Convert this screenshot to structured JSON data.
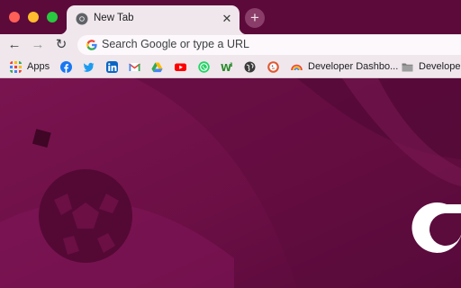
{
  "colors": {
    "tabstrip": "#5c0a3a",
    "toolbar": "#efe7ec",
    "page_bg": "#6b0f45"
  },
  "tab": {
    "title": "New Tab",
    "close_icon": "close-icon"
  },
  "new_tab_label": "+",
  "toolbar": {
    "back": "←",
    "forward": "→",
    "reload": "↻",
    "omnibox_placeholder": "Search Google or type a URL"
  },
  "bookmarks": [
    {
      "name": "apps",
      "label": "Apps",
      "icon": "apps-grid-icon"
    },
    {
      "name": "facebook",
      "label": "",
      "icon": "facebook-icon"
    },
    {
      "name": "twitter",
      "label": "",
      "icon": "twitter-icon"
    },
    {
      "name": "linkedin",
      "label": "",
      "icon": "linkedin-icon"
    },
    {
      "name": "gmail",
      "label": "",
      "icon": "gmail-icon"
    },
    {
      "name": "drive",
      "label": "",
      "icon": "drive-icon"
    },
    {
      "name": "youtube",
      "label": "",
      "icon": "youtube-icon"
    },
    {
      "name": "whatsapp",
      "label": "",
      "icon": "whatsapp-icon"
    },
    {
      "name": "w1",
      "label": "",
      "icon": "w1-icon"
    },
    {
      "name": "globe",
      "label": "",
      "icon": "globe-icon"
    },
    {
      "name": "duckduckgo",
      "label": "",
      "icon": "duckduckgo-icon"
    },
    {
      "name": "developer-dashboard",
      "label": "Developer Dashbo...",
      "icon": "rainbow-icon"
    },
    {
      "name": "developer-folder",
      "label": "Developer",
      "icon": "folder-icon"
    }
  ]
}
